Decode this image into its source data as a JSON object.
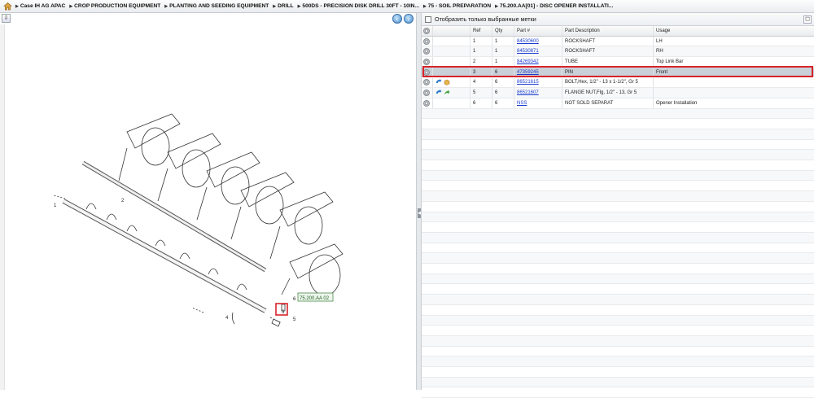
{
  "breadcrumb": {
    "items": [
      "Case IH AG APAC",
      "CROP PRODUCTION EQUIPMENT",
      "PLANTING AND SEEDING EQUIPMENT",
      "DRILL",
      "500DS - PRECISION DISK DRILL 30FT - 10IN...",
      "75 - SOIL PREPARATION",
      "75.200.AA[01] - DISC OPENER INSTALLATI..."
    ]
  },
  "diagram": {
    "callouts": {
      "c1": "1",
      "c2": "2",
      "c3": "3",
      "c4": "4",
      "c5": "5",
      "c6": "6"
    },
    "ref_link": "75.200.AA 02",
    "icons": {
      "prev": "chevron-left-icon",
      "next": "chevron-right-icon"
    }
  },
  "filter": {
    "label": "Отобразить только выбранные метки"
  },
  "table": {
    "headers": {
      "ref": "Ref",
      "qty": "Qty",
      "part": "Part #",
      "desc": "Part Description",
      "usage": "Usage"
    },
    "rows": [
      {
        "ref": "1",
        "qty": "1",
        "part": "84530600",
        "desc": "ROCKSHAFT",
        "usage": "LH"
      },
      {
        "ref": "1",
        "qty": "1",
        "part": "84530871",
        "desc": "ROCKSHAFT",
        "usage": "RH"
      },
      {
        "ref": "2",
        "qty": "1",
        "part": "84269342",
        "desc": "TUBE",
        "usage": "Top Link Bar"
      },
      {
        "ref": "3",
        "qty": "6",
        "part": "47359245",
        "desc": "PIN",
        "usage": "Front"
      },
      {
        "ref": "4",
        "qty": "6",
        "part": "86521615",
        "desc": "BOLT,Hex, 1/2\" - 13 x 1-1/2\", Gr 5",
        "usage": ""
      },
      {
        "ref": "5",
        "qty": "6",
        "part": "86521607",
        "desc": "FLANGE NUT,Flg, 1/2\" - 13, Gr 5",
        "usage": ""
      },
      {
        "ref": "6",
        "qty": "6",
        "part": "NSS",
        "desc": "NOT SOLD SEPARAT",
        "usage": "Opener Installation"
      }
    ]
  },
  "colors": {
    "selection": "#d8232a",
    "link": "#1a3cd0",
    "selected_row": "#c9d0d8"
  }
}
